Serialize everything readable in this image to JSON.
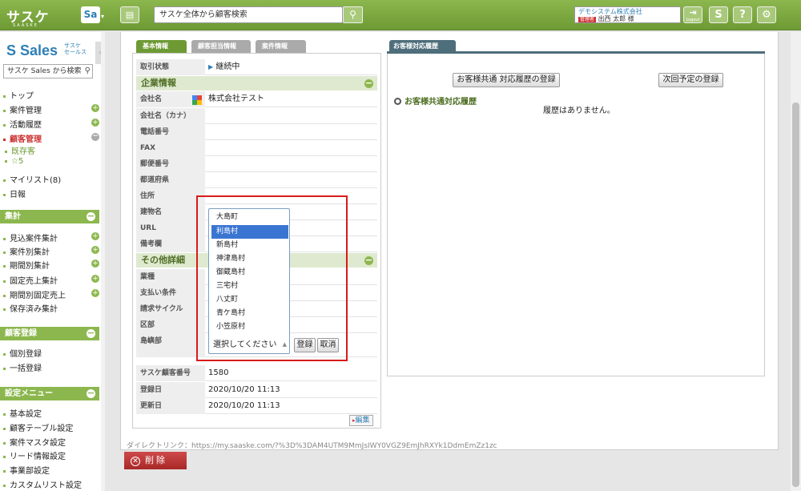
{
  "header": {
    "logo": "サスケ",
    "logo_sub": "SAASKE",
    "app_button": "Sa",
    "search_placeholder": "サスケ全体から顧客検索",
    "company": "デモシステム株式会社",
    "role_badge": "管理者",
    "user_name": "出西 太郎 様",
    "logout_label": "Logout",
    "s_button": "S",
    "help_button": "?",
    "settings_icon": "gear-icon"
  },
  "sidebar": {
    "logo": "Sales",
    "logo_sub1": "サスケ",
    "logo_sub2": "セールス",
    "search_placeholder": "サスケ Sales から検索",
    "nav": [
      "トップ",
      "案件管理",
      "活動履歴",
      "顧客管理"
    ],
    "sub": [
      "既存客",
      "☆5"
    ],
    "nav2": [
      "マイリスト(8)",
      "日報"
    ],
    "sections": [
      {
        "title": "集計",
        "items": [
          "見込案件集計",
          "案件別集計",
          "期間別集計",
          "固定売上集計",
          "期間別固定売上",
          "保存済み集計"
        ]
      },
      {
        "title": "顧客登録",
        "items": [
          "個別登録",
          "一括登録"
        ]
      },
      {
        "title": "設定メニュー",
        "items": [
          "基本設定",
          "顧客テーブル設定",
          "案件マスタ設定",
          "リード情報設定",
          "事業部設定",
          "カスタムリスト設定"
        ]
      }
    ]
  },
  "tabs": {
    "basic": "基本情報",
    "staff": "顧客担当情報",
    "deal": "案件情報"
  },
  "fields": {
    "status_label": "取引状態",
    "status_value": "継続中",
    "group_company": "企業情報",
    "company_name_label": "会社名",
    "company_name_value": "株式会社テスト",
    "kana_label": "会社名（カナ）",
    "phone_label": "電話番号",
    "fax_label": "FAX",
    "zip_label": "郵便番号",
    "pref_label": "都道府県",
    "address_label": "住所",
    "building_label": "建物名",
    "url_label": "URL",
    "note_label": "備考欄",
    "group_other": "その他詳細",
    "industry_label": "業種",
    "payment_label": "支払い条件",
    "billing_label": "請求サイクル",
    "area_label": "区部",
    "island_label": "島嶼部",
    "number_label": "サスケ顧客番号",
    "number_value": "1580",
    "created_label": "登録日",
    "created_value": "2020/10/20 11:13",
    "updated_label": "更新日",
    "updated_value": "2020/10/20 11:13",
    "edit_label": "編集"
  },
  "dropdown": {
    "options": [
      "大島町",
      "利島村",
      "新島村",
      "神津島村",
      "御蔵島村",
      "三宅村",
      "八丈町",
      "青ケ島村",
      "小笠原村"
    ],
    "selected": "利島村",
    "placeholder": "選択してください",
    "register": "登録",
    "cancel": "取消"
  },
  "right": {
    "tab": "お客様対応履歴",
    "common_register": "お客様共通 対応履歴の登録",
    "next_plan": "次回予定の登録",
    "heading": "お客様共通対応履歴",
    "empty": "履歴はありません。"
  },
  "footer": {
    "direct_link": "ダイレクトリンク：https://my.saaske.com/?%3D%3DAM4UTM9MmJsIWY0VGZ9EmJhRXYk1DdmEmZz1zc",
    "delete": "削除"
  }
}
